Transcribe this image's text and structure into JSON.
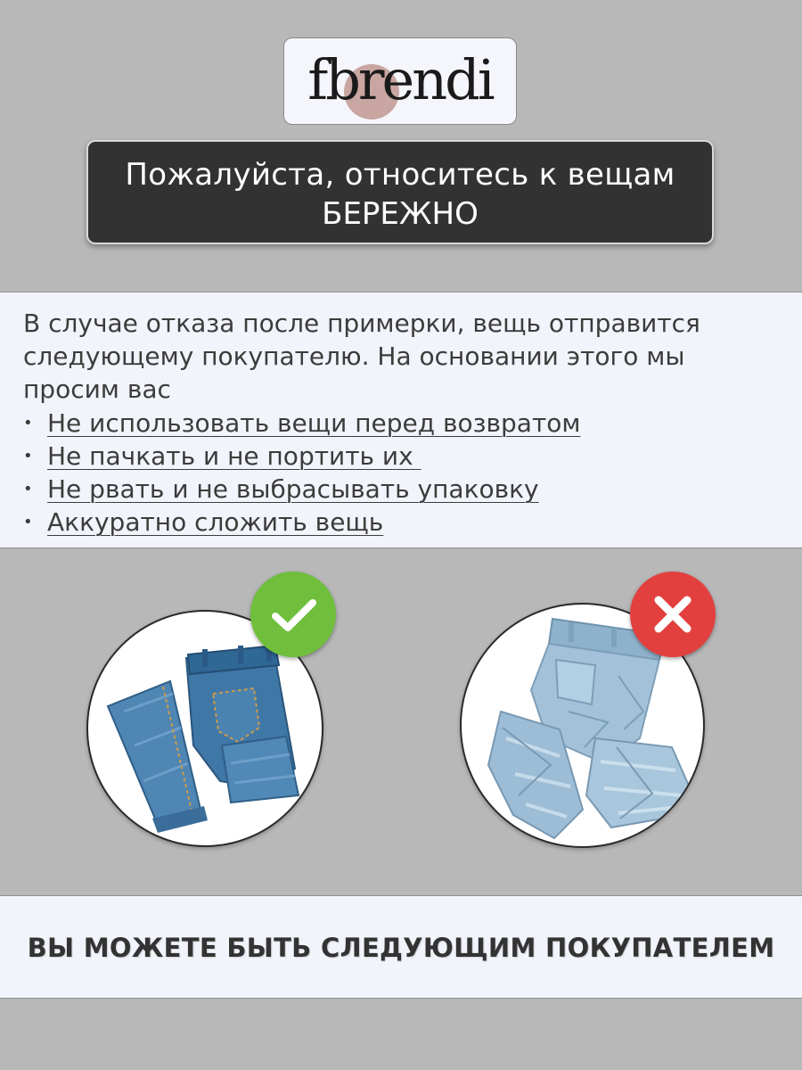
{
  "brand": {
    "logo_text": "fbrendi",
    "logo_circle_color": "#c9a6a2"
  },
  "header": {
    "title_line1": "Пожалуйста, относитесь к вещам",
    "title_line2": "БЕРЕЖНО"
  },
  "info": {
    "paragraph_line1": "В случае отказа после примерки, вещь отправится",
    "paragraph_line2": "следующему покупателю. На основании этого мы",
    "paragraph_line3": "просим вас",
    "rules": [
      "Не использовать вещи перед возвратом",
      "Не пачкать и не портить их ",
      "Не рвать и не выбрасывать упаковку",
      "Аккуратно сложить вещь"
    ],
    "bullet_glyph": "•"
  },
  "examples": {
    "good": {
      "image": "folded-jeans",
      "badge_icon": "checkmark-icon",
      "badge_color": "#6fbf3c"
    },
    "bad": {
      "image": "crumpled-jeans",
      "badge_icon": "cross-icon",
      "badge_color": "#e2403f"
    }
  },
  "footer": {
    "text": "ВЫ МОЖЕТЕ БЫТЬ СЛЕДУЮЩИМ ПОКУПАТЕЛЕМ"
  },
  "colors": {
    "background": "#b8b8b8",
    "band": "#f2f4fb",
    "title_box": "#323232"
  }
}
